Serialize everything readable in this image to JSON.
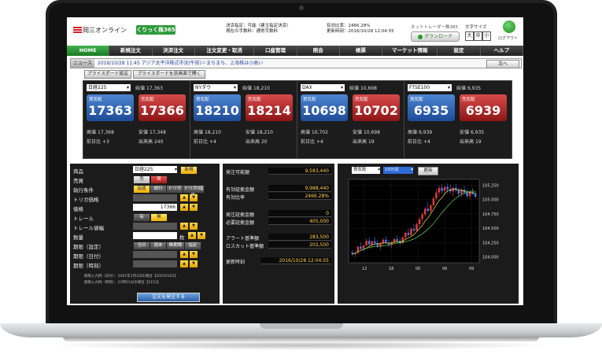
{
  "header": {
    "logo_text": "岡三オンライン",
    "logo_badge": "くりっく株365",
    "settlement_line1": "決済指定：可能（建玉指定決済）",
    "settlement_line2": "現在の手数料：通常手数料",
    "funds_line1": "有効比率：2466.28%",
    "funds_line2": "更新時刻：2016/10/28 12:04:55",
    "net_trader_label": "ネットトレーダー株365",
    "download_label": "ダウンロード",
    "font_size_label": "文字サイズ",
    "font_sizes": [
      "大",
      "中",
      "小"
    ],
    "logout_label": "ログアウト"
  },
  "nav": [
    "HOME",
    "新規注文",
    "決済注文",
    "注文変更・取消",
    "口座管理",
    "照会",
    "帳票",
    "マーケット情報",
    "設定",
    "ヘルプ"
  ],
  "news": {
    "tag": "ニュース",
    "text": "2016/10/28 11:45  アジア太平洋株式市況(午前)＝まちまち、上海株は小高い",
    "next_label": "次へ"
  },
  "buttons": {
    "price_board_settings": "プライスボード設定",
    "price_board_open": "プライスボードを別画面で開く"
  },
  "quotes": [
    {
      "symbol": "日経225",
      "open_label": "始値",
      "open": "17,363",
      "bid_label": "買気配",
      "bid": "17363",
      "ask_label": "売気配",
      "ask": "17366",
      "high_label": "高値",
      "high": "17,368",
      "low_label": "安値",
      "low": "17,348",
      "change_label": "前日比",
      "change": "+3",
      "volume_label": "出来高",
      "volume": "240"
    },
    {
      "symbol": "NYダウ",
      "open_label": "始値",
      "open": "18,210",
      "bid_label": "買気配",
      "bid": "18210",
      "ask_label": "売気配",
      "ask": "18214",
      "high_label": "高値",
      "high": "18,210",
      "low_label": "安値",
      "low": "18,210",
      "change_label": "前日比",
      "change": "+4",
      "volume_label": "出来高",
      "volume": "20"
    },
    {
      "symbol": "DAX",
      "open_label": "始値",
      "open": "10,698",
      "bid_label": "買気配",
      "bid": "10698",
      "ask_label": "売気配",
      "ask": "10702",
      "high_label": "高値",
      "high": "10,702",
      "low_label": "安値",
      "low": "10,698",
      "change_label": "前日比",
      "change": "+4",
      "volume_label": "出来高",
      "volume": "19"
    },
    {
      "symbol": "FTSE100",
      "open_label": "始値",
      "open": "6,935",
      "bid_label": "買気配",
      "bid": "6935",
      "ask_label": "売気配",
      "ask": "6939",
      "high_label": "高値",
      "high": "6,939",
      "low_label": "安値",
      "low": "6,935",
      "change_label": "前日比",
      "change": "+4",
      "volume_label": "出来高",
      "volume": "19"
    }
  ],
  "order": {
    "product_label": "商品",
    "product_value": "日経225",
    "new_label": "新規",
    "side_label": "売買",
    "sell": "売",
    "buy": "買",
    "exec_label": "執行条件",
    "exec_options": [
      "指値",
      "成行",
      "トリガ",
      "トリガ(指値)"
    ],
    "trigger_label": "トリガ価格",
    "price_label": "価格",
    "price_value": "17366",
    "trail_label": "トレール",
    "trail_options": [
      "有",
      "無"
    ],
    "trail_width_label": "トレール値幅",
    "qty_label": "数量",
    "qty_unit": "枚",
    "period_set_label": "期限（設定）",
    "period_options": [
      "当日",
      "週末",
      "無期限",
      "指定"
    ],
    "period_date_label": "期限（日付）",
    "period_time_label": "期限（時刻）",
    "note1": "期限入力例（日付）：2001年1月1日の場合【20010101】",
    "note2": "期限入力例（時刻）：21時51分の場合【2151】",
    "submit_label": "注文を発注する"
  },
  "account": {
    "rows": [
      {
        "label": "発注可能額",
        "value": "9,583,440"
      },
      {
        "label": "有効証拠金額",
        "value": "9,988,440"
      },
      {
        "label": "有効比率",
        "value": "2466.28%"
      },
      {
        "label": "発注証拠金額",
        "value": "0"
      },
      {
        "label": "必要証拠金額",
        "value": "405,000"
      },
      {
        "label": "アラート基準額",
        "value": "283,500"
      },
      {
        "label": "ロスカット基準額",
        "value": "202,500"
      },
      {
        "label": "更新時刻",
        "value": "2016/10/28 12:04:55"
      }
    ]
  },
  "chart_panel": {
    "side_select": "買気配",
    "interval_select": "10分足",
    "refresh_label": "更新"
  },
  "chart_data": {
    "type": "candlestick",
    "y_ticks": [
      "105.250",
      "105.000",
      "104.750",
      "104.500",
      "104.250",
      "104.000"
    ],
    "x_ticks": [
      "12",
      "18",
      "00",
      "06",
      "09"
    ],
    "ylim": [
      103.9,
      105.35
    ],
    "candles": [
      [
        104.08,
        104.12,
        104.02,
        104.05
      ],
      [
        104.05,
        104.1,
        104.0,
        104.07
      ],
      [
        104.07,
        104.2,
        104.05,
        104.18
      ],
      [
        104.18,
        104.25,
        104.12,
        104.14
      ],
      [
        104.14,
        104.22,
        104.1,
        104.2
      ],
      [
        104.2,
        104.32,
        104.18,
        104.28
      ],
      [
        104.28,
        104.34,
        104.18,
        104.22
      ],
      [
        104.22,
        104.3,
        104.15,
        104.27
      ],
      [
        104.27,
        104.35,
        104.2,
        104.24
      ],
      [
        104.24,
        104.3,
        104.16,
        104.18
      ],
      [
        104.18,
        104.26,
        104.12,
        104.24
      ],
      [
        104.24,
        104.33,
        104.2,
        104.3
      ],
      [
        104.3,
        104.36,
        104.22,
        104.25
      ],
      [
        104.25,
        104.3,
        104.18,
        104.22
      ],
      [
        104.22,
        104.28,
        104.15,
        104.26
      ],
      [
        104.26,
        104.34,
        104.22,
        104.31
      ],
      [
        104.31,
        104.38,
        104.25,
        104.28
      ],
      [
        104.28,
        104.33,
        104.2,
        104.24
      ],
      [
        104.24,
        104.36,
        104.22,
        104.34
      ],
      [
        104.34,
        104.45,
        104.3,
        104.42
      ],
      [
        104.42,
        104.5,
        104.35,
        104.38
      ],
      [
        104.38,
        104.52,
        104.36,
        104.49
      ],
      [
        104.49,
        104.58,
        104.42,
        104.46
      ],
      [
        104.46,
        104.6,
        104.44,
        104.57
      ],
      [
        104.57,
        104.7,
        104.52,
        104.66
      ],
      [
        104.66,
        104.78,
        104.6,
        104.74
      ],
      [
        104.74,
        104.88,
        104.7,
        104.84
      ],
      [
        104.84,
        104.95,
        104.78,
        104.8
      ],
      [
        104.8,
        104.92,
        104.75,
        104.9
      ],
      [
        104.9,
        105.05,
        104.86,
        105.02
      ],
      [
        105.02,
        105.18,
        104.98,
        105.12
      ],
      [
        105.12,
        105.25,
        105.05,
        105.2
      ],
      [
        105.2,
        105.27,
        105.1,
        105.15
      ],
      [
        105.15,
        105.24,
        105.08,
        105.22
      ],
      [
        105.22,
        105.28,
        105.12,
        105.18
      ],
      [
        105.18,
        105.26,
        105.1,
        105.14
      ],
      [
        105.14,
        105.22,
        105.05,
        105.2
      ],
      [
        105.2,
        105.27,
        105.12,
        105.16
      ],
      [
        105.16,
        105.22,
        105.06,
        105.1
      ],
      [
        105.1,
        105.2,
        105.04,
        105.17
      ],
      [
        105.17,
        105.24,
        105.1,
        105.12
      ],
      [
        105.12,
        105.18,
        105.02,
        105.06
      ],
      [
        105.06,
        105.16,
        105.0,
        105.13
      ],
      [
        105.13,
        105.2,
        105.08,
        105.1
      ],
      [
        105.1,
        105.14,
        105.02,
        105.05
      ]
    ]
  },
  "colors": {
    "accent_green": "#2e9a3b",
    "bid_blue": "#1d4b98",
    "ask_red": "#8d1616",
    "candle_up": "#e23a3a",
    "candle_down": "#4a7cf0",
    "ma_short": "#e8e24a",
    "ma_long": "#5fd25f"
  }
}
